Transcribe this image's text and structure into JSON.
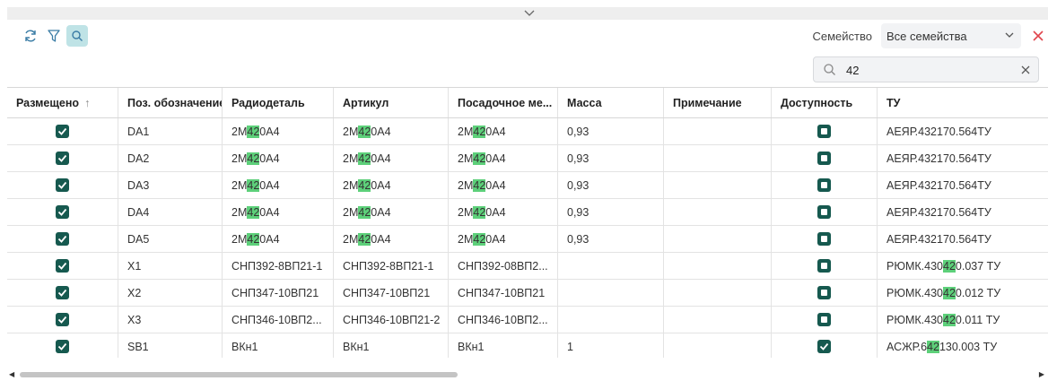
{
  "toolbar": {
    "family_label": "Семейство",
    "family_select_value": "Все семейства"
  },
  "search": {
    "value": "42"
  },
  "colors": {
    "accent": "#16594f",
    "highlight": "#5dd07a",
    "close": "#e0454d",
    "icon": "#3a7ca5"
  },
  "table": {
    "columns": [
      "Размещено",
      "Поз. обозначение",
      "Радиодеталь",
      "Артикул",
      "Посадочное ме...",
      "Масса",
      "Примечание",
      "Доступность",
      "ТУ"
    ],
    "sorted_column": "Размещено",
    "sort_direction": "asc",
    "rows": [
      {
        "placed": true,
        "pos": "DA1",
        "part": [
          "2М",
          "42",
          "0А4"
        ],
        "article": [
          "2М",
          "42",
          "0А4"
        ],
        "footprint": [
          "2М",
          "42",
          "0А4"
        ],
        "mass": "0,93",
        "note": "",
        "available": "square",
        "tu": [
          "АЕЯР.432170.564ТУ",
          "",
          ""
        ]
      },
      {
        "placed": true,
        "pos": "DA2",
        "part": [
          "2М",
          "42",
          "0А4"
        ],
        "article": [
          "2М",
          "42",
          "0А4"
        ],
        "footprint": [
          "2М",
          "42",
          "0А4"
        ],
        "mass": "0,93",
        "note": "",
        "available": "square",
        "tu": [
          "АЕЯР.432170.564ТУ",
          "",
          ""
        ]
      },
      {
        "placed": true,
        "pos": "DA3",
        "part": [
          "2М",
          "42",
          "0А4"
        ],
        "article": [
          "2М",
          "42",
          "0А4"
        ],
        "footprint": [
          "2М",
          "42",
          "0А4"
        ],
        "mass": "0,93",
        "note": "",
        "available": "square",
        "tu": [
          "АЕЯР.432170.564ТУ",
          "",
          ""
        ]
      },
      {
        "placed": true,
        "pos": "DA4",
        "part": [
          "2М",
          "42",
          "0А4"
        ],
        "article": [
          "2М",
          "42",
          "0А4"
        ],
        "footprint": [
          "2М",
          "42",
          "0А4"
        ],
        "mass": "0,93",
        "note": "",
        "available": "square",
        "tu": [
          "АЕЯР.432170.564ТУ",
          "",
          ""
        ]
      },
      {
        "placed": true,
        "pos": "DA5",
        "part": [
          "2М",
          "42",
          "0А4"
        ],
        "article": [
          "2М",
          "42",
          "0А4"
        ],
        "footprint": [
          "2М",
          "42",
          "0А4"
        ],
        "mass": "0,93",
        "note": "",
        "available": "square",
        "tu": [
          "АЕЯР.432170.564ТУ",
          "",
          ""
        ]
      },
      {
        "placed": true,
        "pos": "X1",
        "part": [
          "СНП392-8ВП21-1",
          "",
          ""
        ],
        "article": [
          "СНП392-8ВП21-1",
          "",
          ""
        ],
        "footprint": [
          "СНП392-08ВП2...",
          "",
          ""
        ],
        "mass": "",
        "note": "",
        "available": "square",
        "tu": [
          "РЮМК.430",
          "42",
          "0.037 ТУ"
        ]
      },
      {
        "placed": true,
        "pos": "X2",
        "part": [
          "СНП347-10ВП21",
          "",
          ""
        ],
        "article": [
          "СНП347-10ВП21",
          "",
          ""
        ],
        "footprint": [
          "СНП347-10ВП21",
          "",
          ""
        ],
        "mass": "",
        "note": "",
        "available": "square",
        "tu": [
          "РЮМК.430",
          "42",
          "0.012 ТУ"
        ]
      },
      {
        "placed": true,
        "pos": "X3",
        "part": [
          "СНП346-10ВП2...",
          "",
          ""
        ],
        "article": [
          "СНП346-10ВП21-2",
          "",
          ""
        ],
        "footprint": [
          "СНП346-10ВП2...",
          "",
          ""
        ],
        "mass": "",
        "note": "",
        "available": "square",
        "tu": [
          "РЮМК.430",
          "42",
          "0.011 ТУ"
        ]
      },
      {
        "placed": true,
        "pos": "SB1",
        "part": [
          "ВКн1",
          "",
          ""
        ],
        "article": [
          "ВКн1",
          "",
          ""
        ],
        "footprint": [
          "ВКн1",
          "",
          ""
        ],
        "mass": "1",
        "note": "",
        "available": "check",
        "tu": [
          "АСЖР.6",
          "42",
          "130.003 ТУ"
        ]
      }
    ]
  }
}
